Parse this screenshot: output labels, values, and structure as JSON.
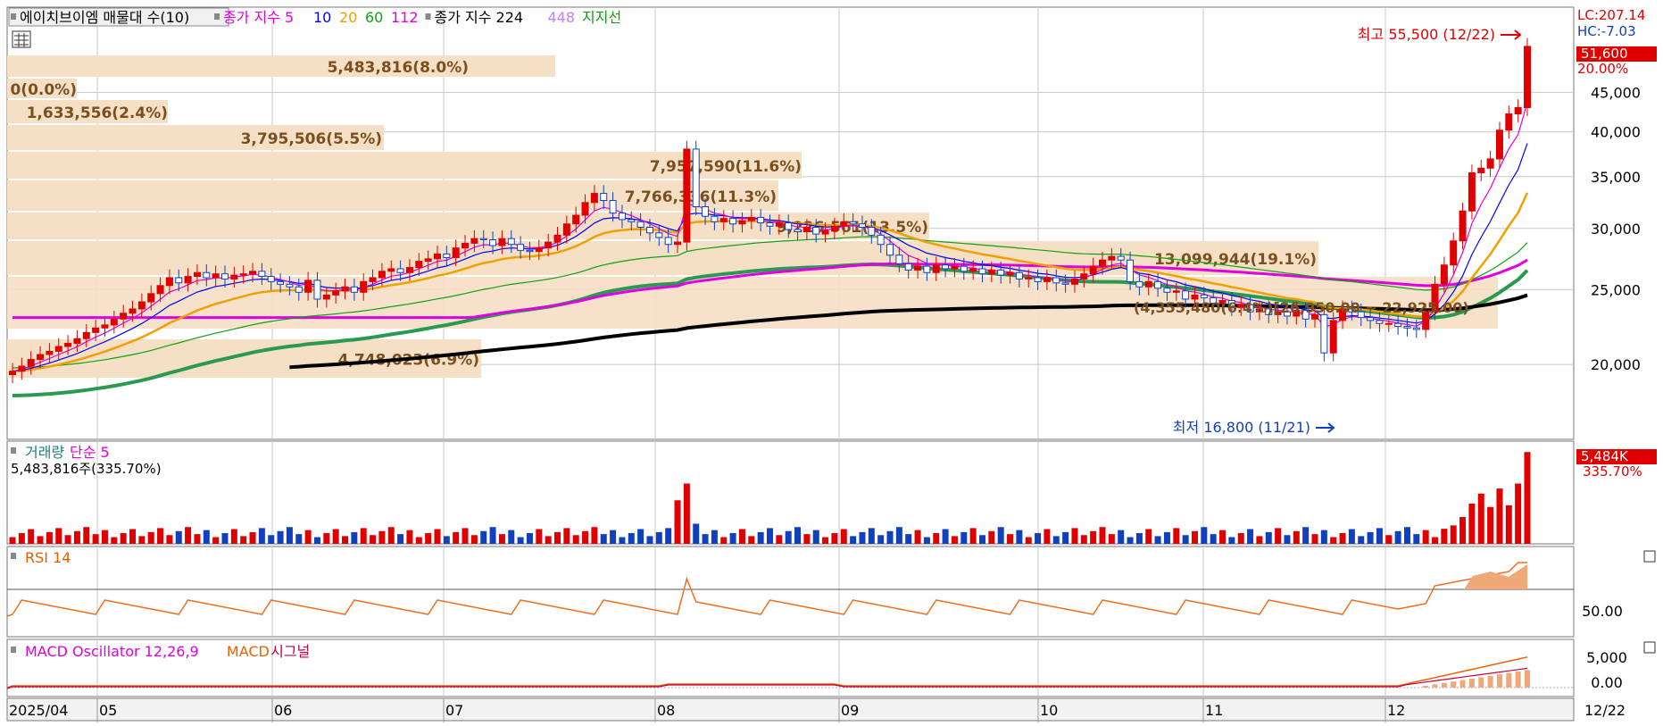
{
  "legend": {
    "price": [
      {
        "text": "에이치브이엠 매물대 수(10)",
        "color": "#000000",
        "boxed": true
      },
      {
        "text": "종가 지수 5",
        "color": "#e000e0"
      },
      {
        "text": "10",
        "color": "#0000ff"
      },
      {
        "text": "20",
        "color": "#f0a000"
      },
      {
        "text": "60",
        "color": "#10a010"
      },
      {
        "text": "112",
        "color": "#e000e0"
      },
      {
        "text": "종가 지수 224",
        "color": "#000000"
      },
      {
        "text": "448",
        "color": "#c080ff"
      },
      {
        "text": "지지선",
        "color": "#10a010"
      }
    ],
    "volume": [
      {
        "text": "거래량",
        "color": "#208080"
      },
      {
        "text": "단순 5",
        "color": "#e000e0"
      }
    ],
    "volume_value": "5,483,816주(335.70%)",
    "rsi": [
      {
        "text": "RSI 14",
        "color": "#e06000"
      }
    ],
    "macd": [
      {
        "text": "MACD Oscillator 12,26,9",
        "color": "#e000e0"
      },
      {
        "text": "MACD",
        "color": "#f06000"
      },
      {
        "text": "시그널",
        "color": "#c00040"
      }
    ]
  },
  "badges": {
    "lc": "LC:207.14",
    "hc": "HC:-7.03",
    "last_price": "51,600",
    "last_pct": "20.00%",
    "vol_box": "5,484K",
    "vol_pct": "335.70%"
  },
  "annotations": {
    "high": "최고 55,500 (12/22)",
    "low": "최저 16,800 (11/21)",
    "range": "(4,355,480(6.4%)[26,950.00 ~ 22,925.00)"
  },
  "axes": {
    "price_ticks": [
      {
        "v": 45000,
        "l": "45,000"
      },
      {
        "v": 40000,
        "l": "40,000"
      },
      {
        "v": 35000,
        "l": "35,000"
      },
      {
        "v": 30000,
        "l": "30,000"
      },
      {
        "v": 25000,
        "l": "25,000"
      },
      {
        "v": 20000,
        "l": "20,000"
      }
    ],
    "rsi_tick": "50.00",
    "macd_ticks": [
      "5,000",
      "0.00"
    ],
    "x_labels": [
      "2025/04",
      "05",
      "06",
      "07",
      "08",
      "09",
      "10",
      "11",
      "12",
      "12/22"
    ]
  },
  "colors": {
    "up": "#e00000",
    "down": "#1040c0",
    "band": "#f5dfc5",
    "band_text": "#7a5020",
    "grid": "#c8c8c8",
    "rsi": "#f07020",
    "fill": "#f0a878"
  },
  "chart_data": {
    "type": "candlestick",
    "price_scale": "log",
    "ylim": [
      16000,
      58000
    ],
    "high": 55500,
    "low": 16800,
    "volume_profile": [
      {
        "label": "0(0.0%)",
        "volume": 0,
        "pct": 0.0
      },
      {
        "label": "1,633,556(2.4%)",
        "volume": 1633556,
        "pct": 2.4
      },
      {
        "label": "3,795,506(5.5%)",
        "volume": 3795506,
        "pct": 5.5
      },
      {
        "label": "4,748,023(6.9%)",
        "volume": 4748023,
        "pct": 6.9
      },
      {
        "label": "5,483,816(8.0%)",
        "volume": 5483816,
        "pct": 8.0
      },
      {
        "label": "7,766,336(11.3%)",
        "volume": 7766336,
        "pct": 11.3
      },
      {
        "label": "7,957,590(11.6%)",
        "volume": 7957590,
        "pct": 11.6
      },
      {
        "label": "9,226,561(13.5%)",
        "volume": 9226561,
        "pct": 13.5
      },
      {
        "label": "13,099,944(19.1%)",
        "volume": 13099944,
        "pct": 19.1
      }
    ],
    "closes": [
      19600,
      19900,
      20300,
      20600,
      20800,
      21100,
      21300,
      21600,
      22000,
      22300,
      22500,
      22900,
      23300,
      23600,
      24100,
      24700,
      25300,
      25900,
      25500,
      26000,
      26300,
      25900,
      26200,
      25800,
      26100,
      26200,
      26400,
      26000,
      25600,
      25400,
      25200,
      24800,
      25700,
      24300,
      24600,
      24900,
      25200,
      24800,
      25600,
      25900,
      26400,
      26600,
      26300,
      26700,
      27200,
      27400,
      27800,
      27500,
      28300,
      28700,
      29100,
      29000,
      28500,
      29100,
      28600,
      28100,
      28000,
      28300,
      28800,
      29400,
      30400,
      31200,
      32400,
      33300,
      32600,
      31400,
      30800,
      30600,
      30100,
      29600,
      29200,
      28600,
      28800,
      38000,
      32000,
      31100,
      30600,
      30900,
      30400,
      30700,
      31000,
      30500,
      30200,
      30500,
      29900,
      29700,
      30100,
      29500,
      29800,
      30200,
      30600,
      30400,
      30100,
      29400,
      28600,
      27700,
      27000,
      26500,
      26800,
      26300,
      26900,
      26600,
      26800,
      26400,
      26600,
      26200,
      26500,
      26100,
      26300,
      25800,
      25900,
      25600,
      25900,
      25500,
      25400,
      25800,
      26200,
      26800,
      27300,
      27600,
      27300,
      25600,
      25200,
      25600,
      25100,
      24800,
      24900,
      24300,
      24600,
      24400,
      24000,
      24200,
      23700,
      23900,
      23400,
      23600,
      23200,
      23400,
      23100,
      23500,
      22900,
      23200,
      20700,
      22800,
      23600,
      23400,
      23000,
      22800,
      22600,
      22600,
      22400,
      22300,
      22200,
      23400,
      25400,
      26900,
      28900,
      31600,
      35400,
      35900,
      36900,
      40200,
      42200,
      43000,
      51600
    ],
    "x_months": [
      "2025/04",
      "05",
      "06",
      "07",
      "08",
      "09",
      "10",
      "11",
      "12"
    ],
    "last_date": "12/22",
    "last_close": 51600,
    "last_change_pct": 20.0,
    "last_volume": 5483816,
    "last_volume_ratio_pct": 335.7
  }
}
